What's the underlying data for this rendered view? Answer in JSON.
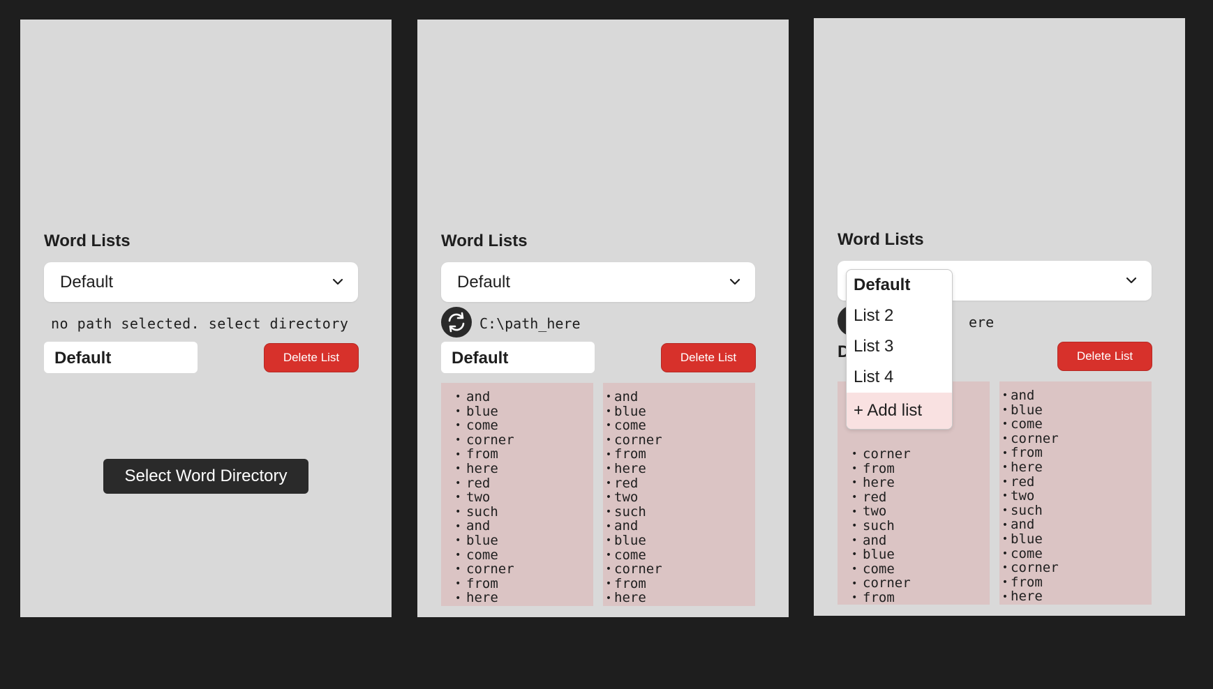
{
  "panels": [
    {
      "title": "Word Lists",
      "select_value": "Default",
      "path_text": "no path selected. select directory",
      "list_name": "Default",
      "delete_label": "Delete List",
      "select_dir_label": "Select Word Directory"
    },
    {
      "title": "Word Lists",
      "select_value": "Default",
      "path_text": "C:\\path_here",
      "list_name": "Default",
      "delete_label": "Delete List",
      "words_left": [
        "and",
        "blue",
        "come",
        "corner",
        "from",
        "here",
        "red",
        "two",
        "such",
        "and",
        "blue",
        "come",
        "corner",
        "from",
        "here"
      ],
      "words_right": [
        "and",
        "blue",
        "come",
        "corner",
        "from",
        "here",
        "red",
        "two",
        "such",
        "and",
        "blue",
        "come",
        "corner",
        "from",
        "here"
      ]
    },
    {
      "title": "Word Lists",
      "path_text_partial": "ere",
      "list_name_partial": "D",
      "delete_label": "Delete List",
      "dropdown_options": [
        "Default",
        "List 2",
        "List 3",
        "List 4",
        "+ Add list"
      ],
      "words_left_visible": [
        "corner",
        "from",
        "here",
        "red",
        "two",
        "such",
        "and",
        "blue",
        "come",
        "corner",
        "from",
        "here"
      ],
      "words_right": [
        "and",
        "blue",
        "come",
        "corner",
        "from",
        "here",
        "red",
        "two",
        "such",
        "and",
        "blue",
        "come",
        "corner",
        "from",
        "here"
      ]
    }
  ],
  "icons": {
    "chevron": "chevron-down-icon",
    "refresh": "refresh-icon"
  },
  "colors": {
    "background": "#1e1e1e",
    "panel": "#d9d9d9",
    "delete_button": "#d7312b",
    "word_column": "#dbc4c4",
    "add_list_highlight": "#f9e1e1"
  }
}
